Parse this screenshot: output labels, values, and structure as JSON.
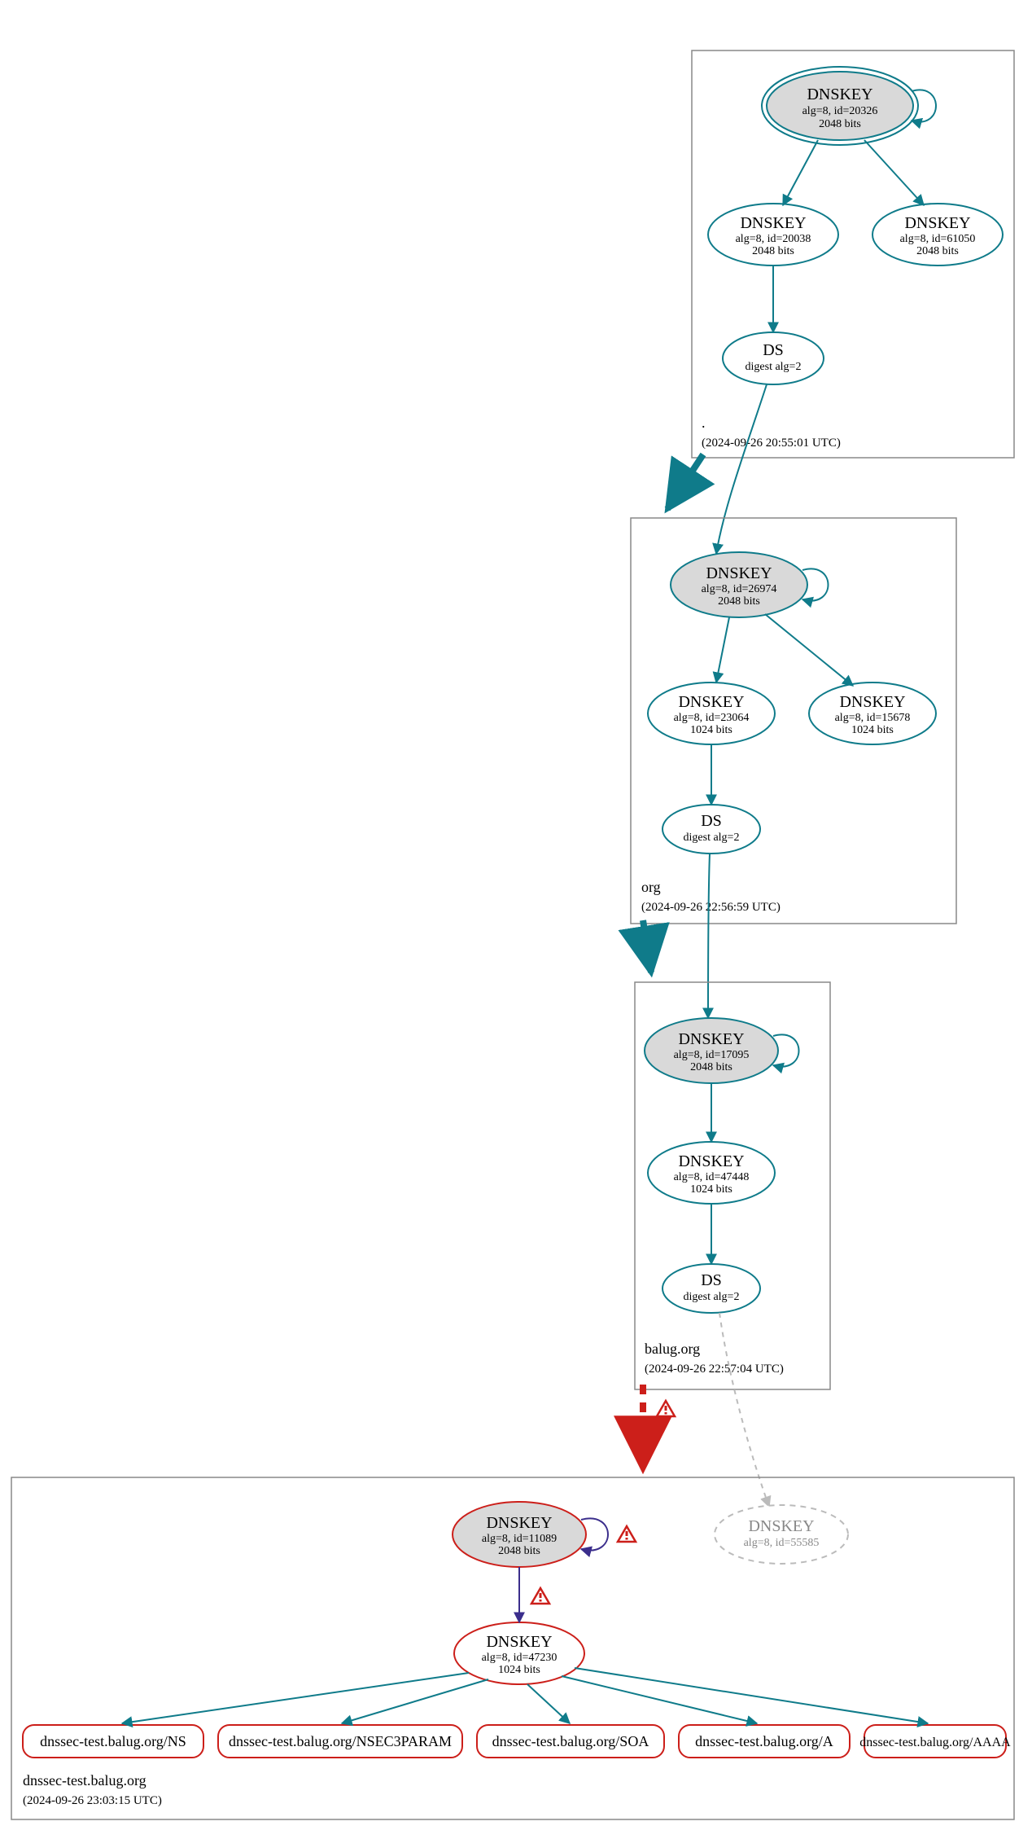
{
  "zones": {
    "root": {
      "name": ".",
      "time": "(2024-09-26 20:55:01 UTC)"
    },
    "org": {
      "name": "org",
      "time": "(2024-09-26 22:56:59 UTC)"
    },
    "balug": {
      "name": "balug.org",
      "time": "(2024-09-26 22:57:04 UTC)"
    },
    "dnssec": {
      "name": "dnssec-test.balug.org",
      "time": "(2024-09-26 23:03:15 UTC)"
    }
  },
  "nodes": {
    "root_ksk": {
      "title": "DNSKEY",
      "l1": "alg=8, id=20326",
      "l2": "2048 bits"
    },
    "root_zsk1": {
      "title": "DNSKEY",
      "l1": "alg=8, id=20038",
      "l2": "2048 bits"
    },
    "root_zsk2": {
      "title": "DNSKEY",
      "l1": "alg=8, id=61050",
      "l2": "2048 bits"
    },
    "root_ds": {
      "title": "DS",
      "l1": "digest alg=2"
    },
    "org_ksk": {
      "title": "DNSKEY",
      "l1": "alg=8, id=26974",
      "l2": "2048 bits"
    },
    "org_zsk1": {
      "title": "DNSKEY",
      "l1": "alg=8, id=23064",
      "l2": "1024 bits"
    },
    "org_zsk2": {
      "title": "DNSKEY",
      "l1": "alg=8, id=15678",
      "l2": "1024 bits"
    },
    "org_ds": {
      "title": "DS",
      "l1": "digest alg=2"
    },
    "balug_ksk": {
      "title": "DNSKEY",
      "l1": "alg=8, id=17095",
      "l2": "2048 bits"
    },
    "balug_zsk": {
      "title": "DNSKEY",
      "l1": "alg=8, id=47448",
      "l2": "1024 bits"
    },
    "balug_ds": {
      "title": "DS",
      "l1": "digest alg=2"
    },
    "dnssec_ksk": {
      "title": "DNSKEY",
      "l1": "alg=8, id=11089",
      "l2": "2048 bits"
    },
    "dnssec_missing": {
      "title": "DNSKEY",
      "l1": "alg=8, id=55585"
    },
    "dnssec_zsk": {
      "title": "DNSKEY",
      "l1": "alg=8, id=47230",
      "l2": "1024 bits"
    }
  },
  "rr": {
    "ns": "dnssec-test.balug.org/NS",
    "n3p": "dnssec-test.balug.org/NSEC3PARAM",
    "soa": "dnssec-test.balug.org/SOA",
    "a": "dnssec-test.balug.org/A",
    "aaaa": "dnssec-test.balug.org/AAAA"
  }
}
